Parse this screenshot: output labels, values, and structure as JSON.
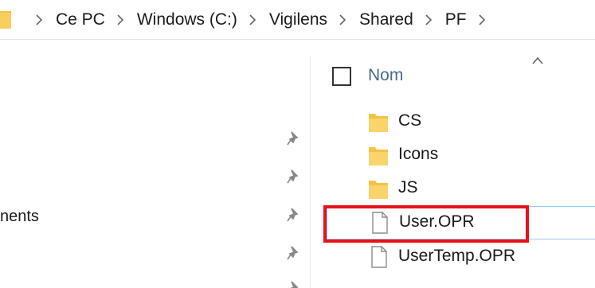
{
  "address_bar": {
    "crumbs": [
      "Ce PC",
      "Windows (C:)",
      "Vigilens",
      "Shared",
      "PF"
    ],
    "icon": "folder-icon"
  },
  "nav_pane": {
    "partial_label": "nents",
    "pin_icon": "pin-icon"
  },
  "file_list": {
    "column_header": "Nom",
    "items": [
      {
        "name": "CS",
        "type": "folder"
      },
      {
        "name": "Icons",
        "type": "folder"
      },
      {
        "name": "JS",
        "type": "folder"
      },
      {
        "name": "User.OPR",
        "type": "file",
        "selected": true
      },
      {
        "name": "UserTemp.OPR",
        "type": "file"
      }
    ]
  },
  "colors": {
    "folder": "#f5c244",
    "header_text": "#4a6a8a",
    "selection_border": "#99c9ef",
    "highlight": "#e8101a"
  }
}
